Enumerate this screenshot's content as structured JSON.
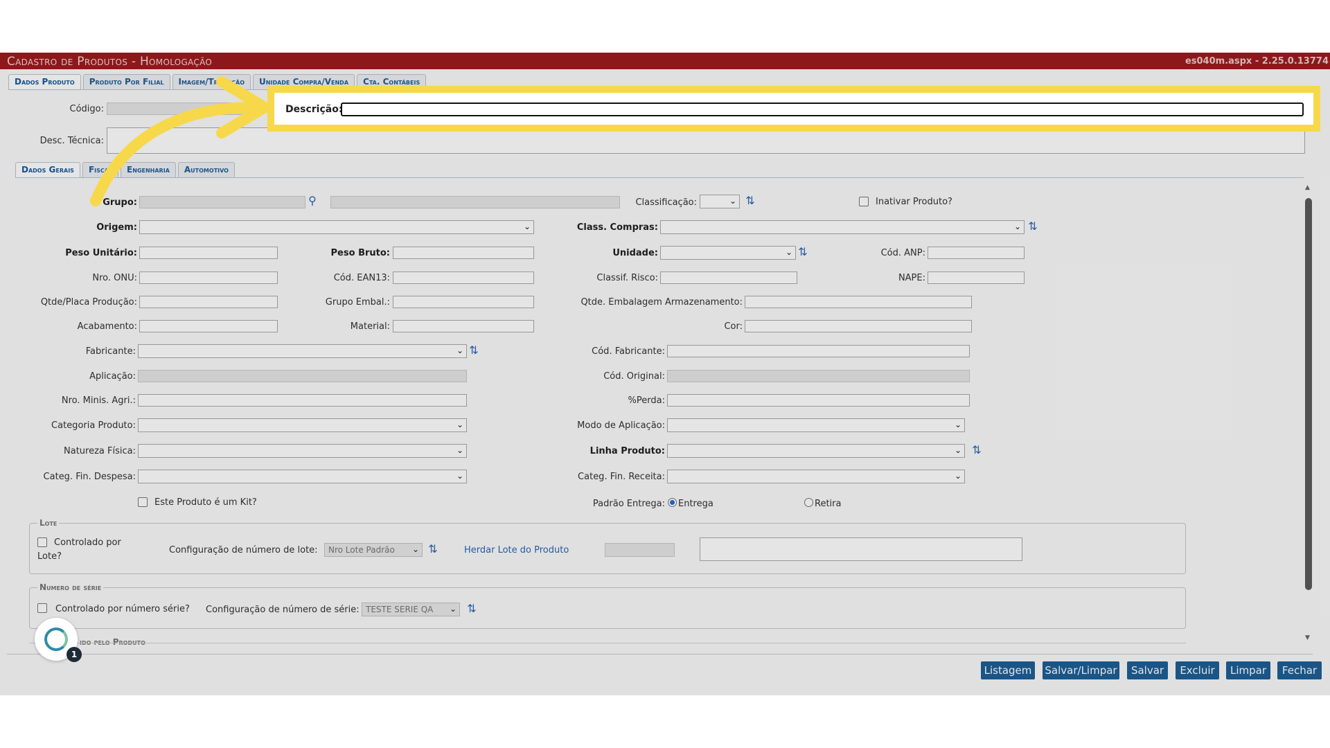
{
  "window": {
    "title": "Cadastro de Produtos - Homologação",
    "version": "es040m.aspx - 2.25.0.13774"
  },
  "top_tabs": [
    "Dados Produto",
    "Produto Por Filial",
    "Imagem/Tradução",
    "Unidade Compra/Venda",
    "Cta. Contábeis"
  ],
  "header": {
    "codigo_label": "Código:",
    "descricao_label": "Descrição:",
    "desc_tecnica_label": "Desc. Técnica:"
  },
  "sub_tabs": [
    "Dados Gerais",
    "Fiscal",
    "Engenharia",
    "Automotivo"
  ],
  "fields": {
    "grupo": "Grupo:",
    "classificacao": "Classificação:",
    "inativar": "Inativar Produto?",
    "origem": "Origem:",
    "class_compras": "Class. Compras:",
    "peso_unitario": "Peso Unitário:",
    "peso_bruto": "Peso Bruto:",
    "unidade": "Unidade:",
    "cod_anp": "Cód. ANP:",
    "nro_onu": "Nro. ONU:",
    "cod_ean13": "Cód. EAN13:",
    "classif_risco": "Classif. Risco:",
    "nape": "NAPE:",
    "qtde_placa": "Qtde/Placa Produção:",
    "grupo_embal": "Grupo Embal.:",
    "qtde_embalagem": "Qtde. Embalagem Armazenamento:",
    "acabamento": "Acabamento:",
    "material": "Material:",
    "cor": "Cor:",
    "fabricante": "Fabricante:",
    "cod_fabricante": "Cód. Fabricante:",
    "aplicacao": "Aplicação:",
    "cod_original": "Cód. Original:",
    "nro_minis_agri": "Nro. Minis. Agri.:",
    "perda": "%Perda:",
    "categoria_produto": "Categoria Produto:",
    "modo_aplicacao": "Modo de Aplicação:",
    "natureza_fisica": "Natureza Física:",
    "linha_produto": "Linha Produto:",
    "categ_fin_despesa": "Categ. Fin. Despesa:",
    "categ_fin_receita": "Categ. Fin. Receita:",
    "kit": "Este Produto é um Kit?",
    "padrao_entrega": "Padrão Entrega:",
    "entrega": "Entrega",
    "retira": "Retira"
  },
  "lote": {
    "legend": "Lote",
    "controlado_line1": "Controlado por",
    "controlado_line2": "Lote?",
    "config_label": "Configuração de número de lote:",
    "config_value": "Nro Lote Padrão",
    "herdar_link": "Herdar Lote do Produto"
  },
  "serie": {
    "legend": "Numero de série",
    "controlado": "Controlado por número série?",
    "config_label": "Configuração de número de série:",
    "config_value": "TESTE SERIE QA"
  },
  "partial_legend": "ido pelo Produto",
  "buttons": [
    "Listagem",
    "Salvar/Limpar",
    "Salvar",
    "Excluir",
    "Limpar",
    "Fechar"
  ],
  "assistant": {
    "badge": "1"
  },
  "colors": {
    "titlebar": "#9e1b1f",
    "button": "#1e5f96",
    "highlight": "#f7d84a",
    "arrow": "#f7d84a"
  }
}
